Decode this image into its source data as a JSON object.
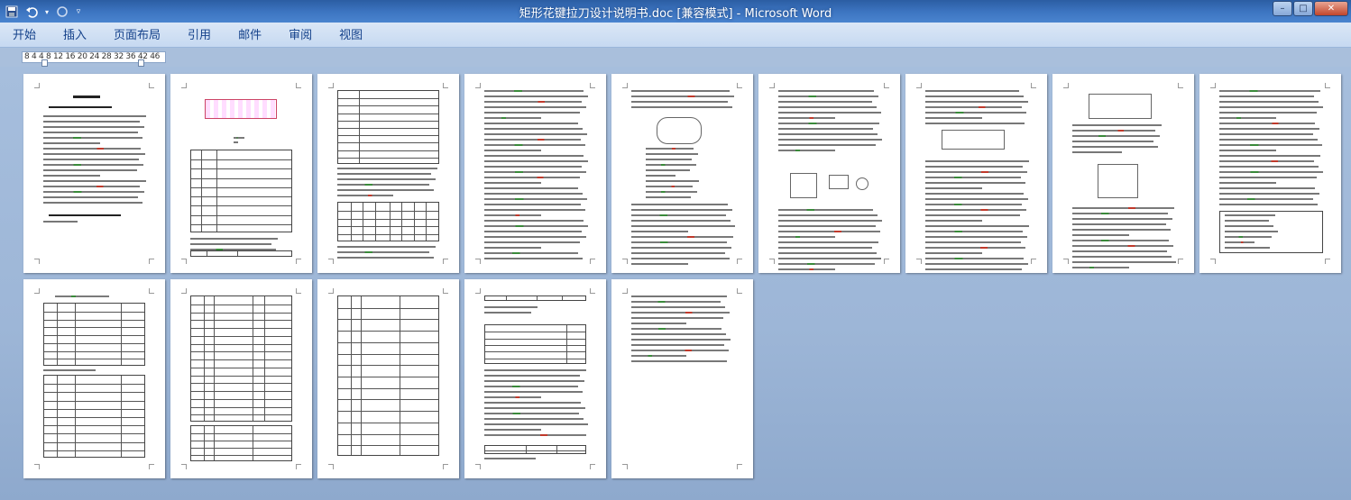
{
  "window": {
    "title": "矩形花键拉刀设计说明书.doc [兼容模式] - Microsoft Word",
    "controls": [
      "–",
      "□",
      "✕"
    ]
  },
  "quick_access": {
    "save_icon": "save-icon",
    "undo_icon": "undo-icon",
    "redo_icon": "redo-icon",
    "customize_icon": "dropdown-icon"
  },
  "ribbon": {
    "tabs": [
      "开始",
      "插入",
      "页面布局",
      "引用",
      "邮件",
      "审阅",
      "视图"
    ]
  },
  "ruler": {
    "text": "8  4     4  8 12 16 20 24 28 32 36  42 46"
  },
  "pages_row1_count": 9,
  "pages_row2_count": 5
}
